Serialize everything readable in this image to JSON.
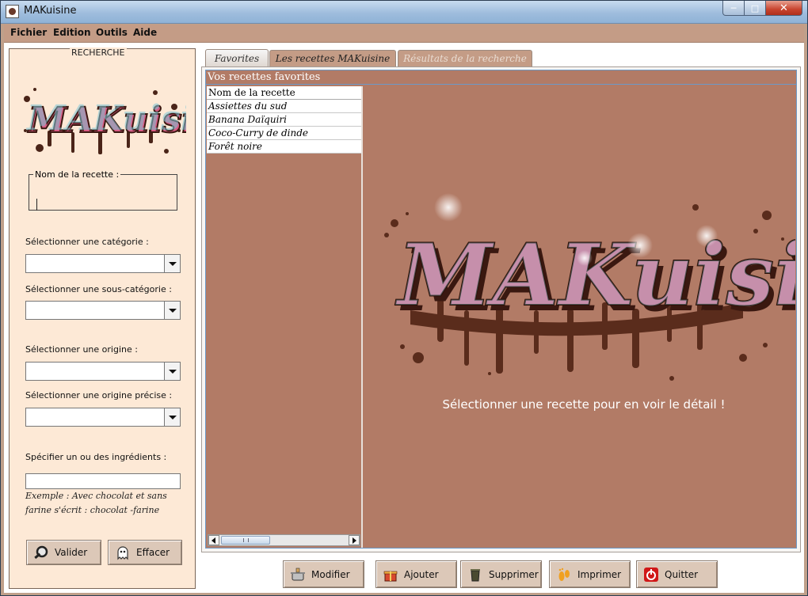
{
  "window": {
    "title": "MAKuisine"
  },
  "menu": [
    "Fichier",
    "Edition",
    "Outils",
    "Aide"
  ],
  "search": {
    "group_title": "RECHERCHE",
    "name_label": "Nom de la recette :",
    "category_label": "Sélectionner une catégorie :",
    "subcategory_label": "Sélectionner une sous-catégorie :",
    "origin_label": "Sélectionner une origine :",
    "precise_origin_label": "Sélectionner une origine précise :",
    "ingredients_label": "Spécifier un ou des ingrédients :",
    "hint_line1": "Exemple : Avec chocolat et sans",
    "hint_line2": "farine s'écrit : chocolat -farine",
    "validate_label": "Valider",
    "clear_label": "Effacer"
  },
  "tabs": [
    "Favorites",
    "Les recettes MAKuisine",
    "Résultats de la recherche"
  ],
  "favorites": {
    "header": "Vos recettes favorites",
    "column": "Nom de la recette",
    "items": [
      "Assiettes du sud",
      "Banana Daïquiri",
      "Coco-Curry de dinde",
      "Forêt noire"
    ],
    "select_message": "Sélectionner une recette pour en voir le détail !"
  },
  "actions": {
    "modify": "Modifier",
    "add": "Ajouter",
    "delete": "Supprimer",
    "print": "Imprimer",
    "quit": "Quitter"
  },
  "logo_text": "MAKuisine",
  "colors": {
    "accent": "#b27b66",
    "panel": "#fde9d6",
    "frame": "#c0a08a"
  }
}
